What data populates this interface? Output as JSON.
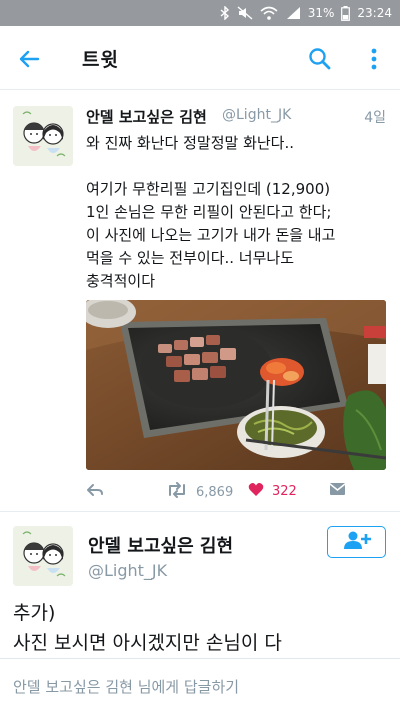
{
  "status_bar": {
    "battery_percent": "31%",
    "time": "23:24",
    "icons": [
      "bluetooth-icon",
      "mute-icon",
      "wifi-icon",
      "signal-icon",
      "battery-icon"
    ]
  },
  "app_bar": {
    "title": "트윗",
    "icons": [
      "back-arrow-icon",
      "search-icon",
      "more-vert-icon"
    ]
  },
  "tweet": {
    "author_name": "안델 보고싶은 김현",
    "author_handle": "@Light_JK",
    "time": "4일",
    "text_lines": [
      "와 진짜 화난다 정말정말 화난다..",
      "",
      "여기가 무한리필 고기집인데 (12,900)",
      "1인 손님은 무한 리필이 안된다고 한다;",
      "이 사진에 나오는 고기가 내가 돈을 내고",
      "먹을 수 있는 전부이다.. 너무나도",
      "충격적이다"
    ],
    "retweet_count": "6,869",
    "like_count": "322",
    "liked": true
  },
  "reply_tweet": {
    "author_name": "안델 보고싶은 김현",
    "author_handle": "@Light_JK",
    "text_lines": [
      "추가)",
      "사진 보시면 아시겠지만 손님이 다"
    ]
  },
  "reply_bar": {
    "placeholder": "안델 보고싶은 김현 님에게 답글하기"
  },
  "colors": {
    "accent": "#1da1f2",
    "like": "#e0245e",
    "secondary_text": "#8899a6",
    "status_bar": "#969a9e"
  }
}
